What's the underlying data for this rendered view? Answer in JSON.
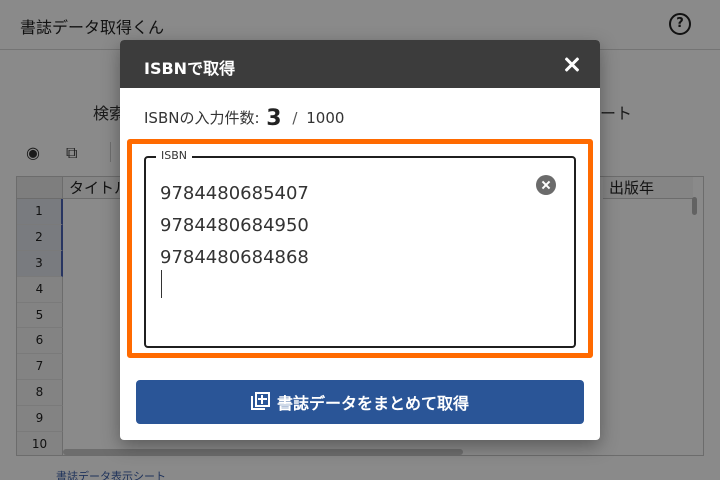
{
  "app": {
    "title": "書誌データ取得くん",
    "help_icon": "help-circle-icon",
    "help_glyph": "?"
  },
  "background": {
    "heading_left": "検索",
    "heading_right": "ート",
    "toolbar": {
      "view_icon": "eye-icon",
      "view_glyph": "◉",
      "copy_icon": "copy-icon",
      "copy_glyph": "⧉"
    },
    "grid": {
      "columns": [
        "タイトル",
        "出版年"
      ],
      "row_numbers": [
        "1",
        "2",
        "3",
        "4",
        "5",
        "6",
        "7",
        "8",
        "9",
        "10"
      ],
      "selected_rows": [
        "1",
        "2",
        "3"
      ]
    },
    "sheet_tab": "書誌データ表示シート"
  },
  "dialog": {
    "title": "ISBNで取得",
    "close_icon": "close-icon",
    "count": {
      "label": "ISBNの入力件数:",
      "value": "3",
      "separator": "/",
      "max": "1000"
    },
    "field": {
      "label": "ISBN",
      "value": "9784480685407\n9784480684950\n9784480684868\n",
      "clear_icon": "clear-circle-icon"
    },
    "highlight_color": "#ff6a00",
    "submit_button": {
      "label": "書誌データをまとめて取得",
      "icon": "library-add-icon",
      "color": "#2a5597"
    }
  }
}
